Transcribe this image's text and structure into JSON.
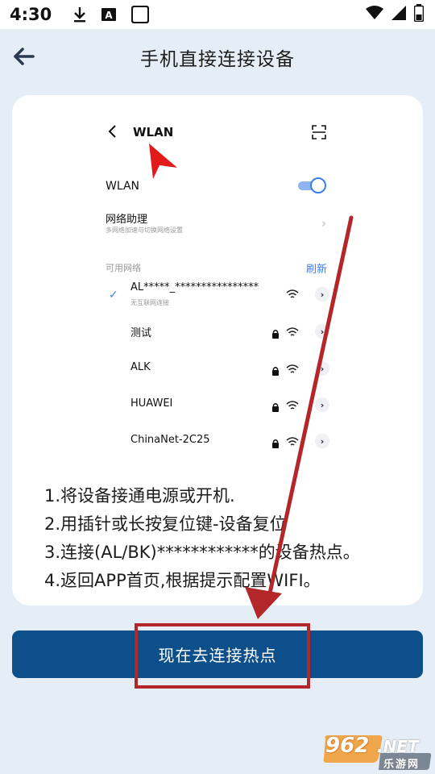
{
  "status_bar": {
    "time": "4:30",
    "icons": [
      "download-icon",
      "font-a-icon",
      "blank-square-icon"
    ],
    "right_icons": [
      "wifi-icon",
      "signal-icon",
      "battery-icon"
    ]
  },
  "header": {
    "title": "手机直接连接设备",
    "back_icon": "back-arrow-icon"
  },
  "illustration": {
    "title": "WLAN",
    "wlan_label": "WLAN",
    "wlan_enabled": true,
    "assistant_title": "网络助理",
    "assistant_sub": "多网络加速与切换网络设置",
    "available_label": "可用网络",
    "refresh_label": "刷新",
    "connected_network": {
      "name": "AL*****_****************",
      "status": "无互联网连接"
    },
    "networks": [
      {
        "name": "测试",
        "locked": true
      },
      {
        "name": "ALK",
        "locked": true
      },
      {
        "name": "HUAWEI",
        "locked": true
      },
      {
        "name": "ChinaNet-2C25",
        "locked": true
      }
    ]
  },
  "instructions": [
    "1.将设备接通电源或开机.",
    "2.用插针或长按复位键-设备复位",
    "3.连接(AL/BK)************的设备热点。",
    "4.返回APP首页,根据提示配置WIFI。"
  ],
  "cta_label": "现在去连接热点",
  "watermark": {
    "top": "962",
    "net": ".NET",
    "sub": "乐游网"
  },
  "colors": {
    "background": "#e5eef6",
    "card": "#ffffff",
    "button": "#0d4f8b",
    "highlight": "#b3262a",
    "accent_blue": "#3b7ee8"
  }
}
